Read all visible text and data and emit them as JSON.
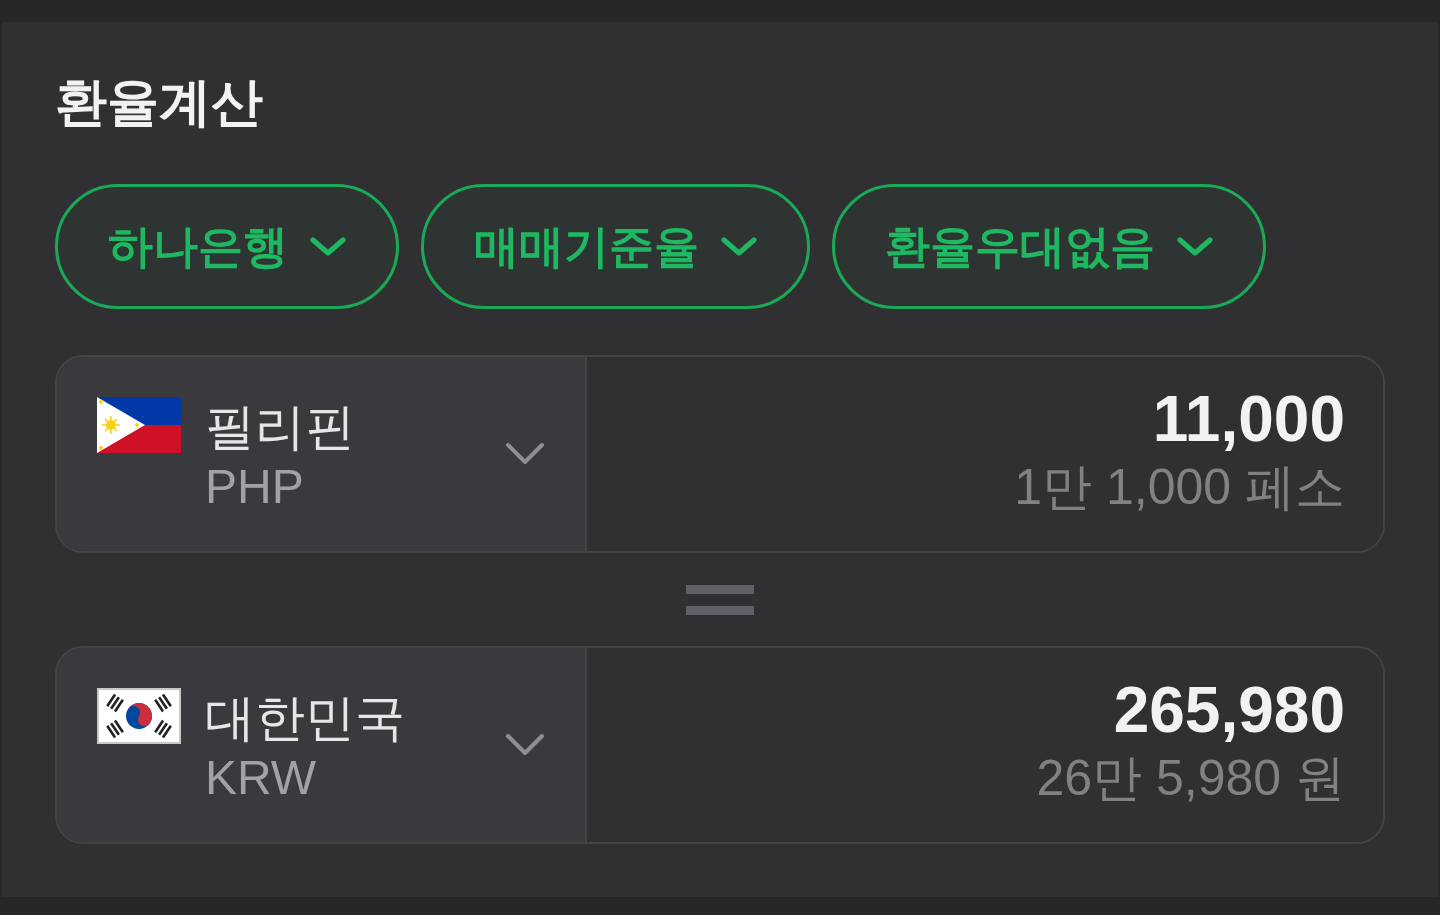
{
  "title": "환율계산",
  "filters": [
    {
      "label": "하나은행"
    },
    {
      "label": "매매기준율"
    },
    {
      "label": "환율우대없음"
    }
  ],
  "currencies": [
    {
      "country": "필리핀",
      "code": "PHP",
      "amount": "11,000",
      "amount_words": "1만 1,000 페소"
    },
    {
      "country": "대한민국",
      "code": "KRW",
      "amount": "265,980",
      "amount_words": "26만 5,980 원"
    }
  ]
}
